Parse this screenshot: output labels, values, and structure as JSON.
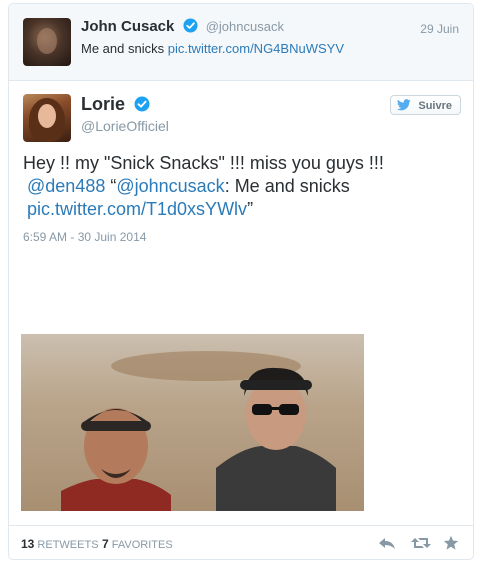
{
  "parent_tweet": {
    "name": "John Cusack",
    "handle": "@johncusack",
    "date": "29 Juin",
    "text": "Me and snicks",
    "link": "pic.twitter.com/NG4BNuWSYV"
  },
  "tweet": {
    "name": "Lorie",
    "handle": "@LorieOfficiel",
    "follow_label": "Suivre",
    "text_line1": "Hey !! my \"Snick Snacks\" !!! miss you guys !!!",
    "mention1": "@den488",
    "quote_open": "“",
    "mention2": "@johncusack",
    "text_after_mention2": ": Me and snicks",
    "link": "pic.twitter.com/T1d0xsYWlv",
    "quote_close": "”",
    "timestamp": "6:59 AM - 30 Juin 2014"
  },
  "stats": {
    "retweets_count": "13",
    "retweets_label": "RETWEETS",
    "favorites_count": "7",
    "favorites_label": "FAVORITES"
  },
  "colors": {
    "link": "#2b7bb9",
    "verified": "#1da1f2",
    "muted": "#8899a6",
    "text": "#292f33"
  },
  "icons": [
    "verified-icon",
    "twitter-bird-icon",
    "reply-icon",
    "retweet-icon",
    "favorite-icon"
  ]
}
